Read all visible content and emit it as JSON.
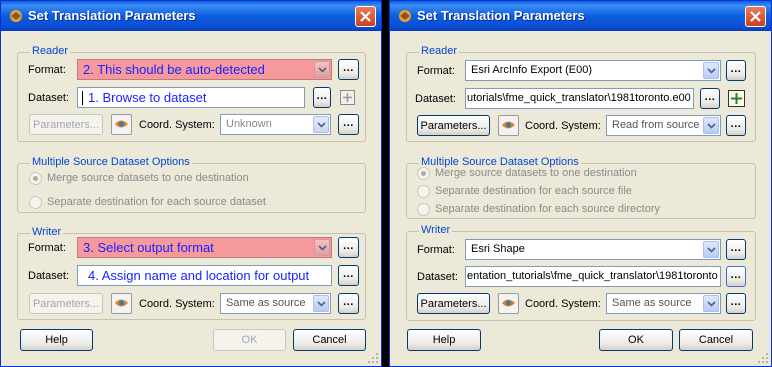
{
  "left": {
    "title": "Set Translation Parameters",
    "reader": {
      "group_label": "Reader",
      "format_label": "Format:",
      "format_value": "2. This should be auto-detected",
      "dataset_label": "Dataset:",
      "dataset_value": "1. Browse to dataset",
      "parameters_label": "Parameters...",
      "coord_label": "Coord. System:",
      "coord_value": "Unknown"
    },
    "multi": {
      "group_label": "Multiple Source Dataset Options",
      "options": [
        "Merge source datasets to one destination",
        "Separate destination for each source dataset"
      ]
    },
    "writer": {
      "group_label": "Writer",
      "format_label": "Format:",
      "format_value": "3. Select output format",
      "dataset_label": "Dataset:",
      "dataset_value": "4. Assign name and location for output",
      "parameters_label": "Parameters...",
      "coord_label": "Coord. System:",
      "coord_value": "Same as source"
    },
    "buttons": {
      "help": "Help",
      "ok": "OK",
      "cancel": "Cancel"
    }
  },
  "right": {
    "title": "Set Translation Parameters",
    "reader": {
      "group_label": "Reader",
      "format_label": "Format:",
      "format_value": "Esri ArcInfo Export (E00)",
      "dataset_label": "Dataset:",
      "dataset_value": "utorials\\fme_quick_translator\\1981toronto.e00",
      "parameters_label": "Parameters...",
      "coord_label": "Coord. System:",
      "coord_value": "Read from source"
    },
    "multi": {
      "group_label": "Multiple Source Dataset Options",
      "options": [
        "Merge source datasets to one destination",
        "Separate destination for each source file",
        "Separate destination for each source directory"
      ]
    },
    "writer": {
      "group_label": "Writer",
      "format_label": "Format:",
      "format_value": "Esri Shape",
      "dataset_label": "Dataset:",
      "dataset_value": "entation_tutorials\\fme_quick_translator\\1981toronto",
      "parameters_label": "Parameters...",
      "coord_label": "Coord. System:",
      "coord_value": "Same as source"
    },
    "buttons": {
      "help": "Help",
      "ok": "OK",
      "cancel": "Cancel"
    }
  },
  "ellipsis_label": "...",
  "colors": {
    "titlebar": "#0a5fe0",
    "group_label": "#0046d5",
    "highlight": "#f5999c",
    "instruction_text": "#1a23ff",
    "close_button": "#c9401f"
  },
  "icons": {
    "app": "fme-app-icon",
    "close": "close-icon",
    "plus": "plus-icon",
    "coord": "coordinate-system-icon",
    "dropdown": "chevron-down-icon",
    "resize": "resize-grip-icon"
  }
}
